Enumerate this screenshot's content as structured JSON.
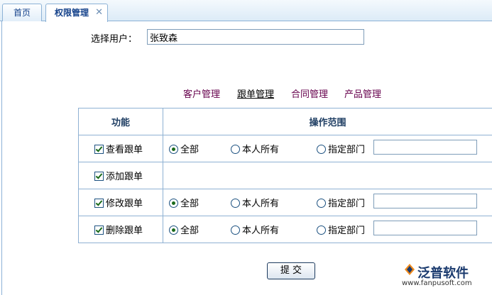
{
  "tabs": {
    "home": "首页",
    "active": "权限管理",
    "close_glyph": "✕"
  },
  "user": {
    "label": "选择用户：",
    "value": "张致森"
  },
  "categories": [
    "客户管理",
    "跟单管理",
    "合同管理",
    "产品管理"
  ],
  "selected_category": "跟单管理",
  "table": {
    "header_function": "功能",
    "header_scope": "操作范围",
    "rows": [
      {
        "function": "查看跟单",
        "checked": true,
        "has_scope": true,
        "selected": "全部"
      },
      {
        "function": "添加跟单",
        "checked": true,
        "has_scope": false
      },
      {
        "function": "修改跟单",
        "checked": true,
        "has_scope": true,
        "selected": "全部"
      },
      {
        "function": "删除跟单",
        "checked": true,
        "has_scope": true,
        "selected": "全部"
      }
    ],
    "scope_options": [
      "全部",
      "本人所有",
      "指定部门"
    ]
  },
  "submit_label": "提 交",
  "logo": {
    "brand": "泛普软件",
    "url": "www.fanpusoft.com"
  }
}
